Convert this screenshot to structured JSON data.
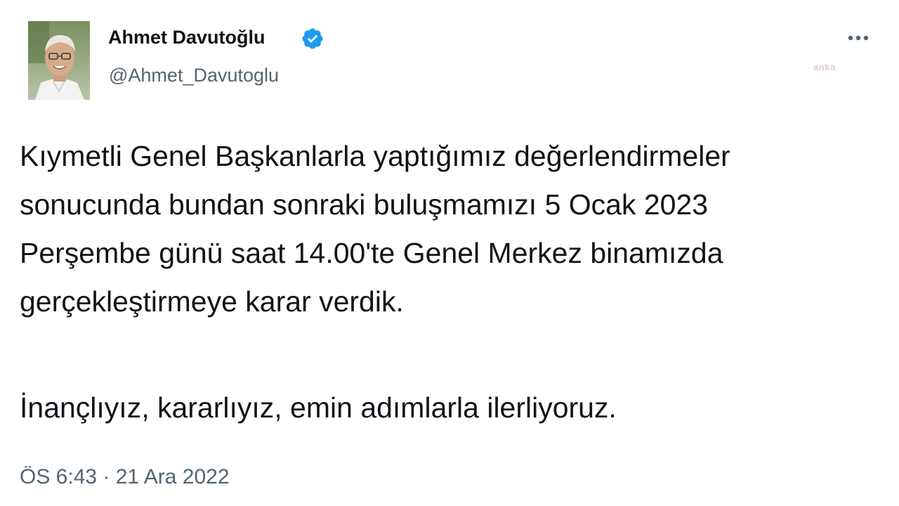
{
  "author": {
    "name": "Ahmet Davutoğlu",
    "handle": "@Ahmet_Davutoglu",
    "verified_color": "#1d9bf0"
  },
  "icons": {
    "verified": "verified-badge-icon",
    "more": "more-horizontal-icon"
  },
  "watermark": "anka",
  "tweet": {
    "paragraph_1": "Kıymetli Genel Başkanlarla yaptığımız değerlendirmeler\nsonucunda bundan sonraki buluşmamızı 5 Ocak 2023\nPerşembe günü saat 14.00'te Genel Merkez binamızda\ngerçekleştirmeye karar verdik.",
    "paragraph_2": "İnançlıyız, kararlıyız, emin adımlarla ilerliyoruz.",
    "timestamp": "ÖS 6:43 · 21 Ara 2022"
  }
}
